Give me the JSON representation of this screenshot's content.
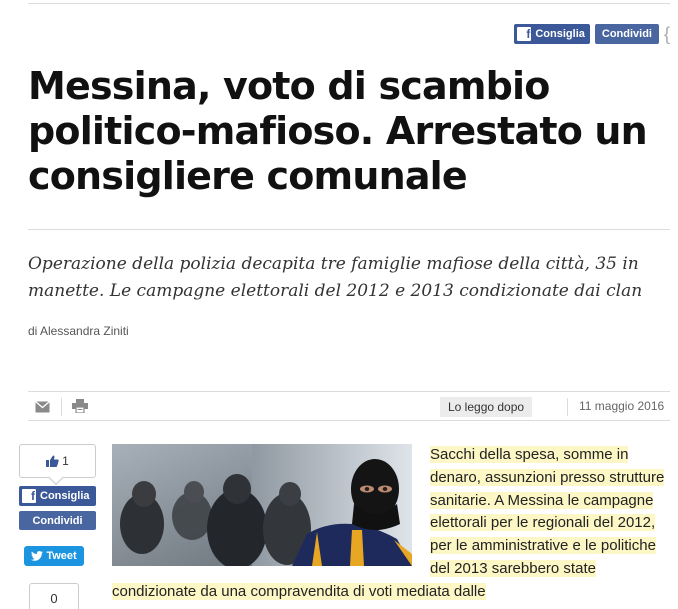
{
  "share_top": {
    "like_label": "Consiglia",
    "share_label": "Condividi"
  },
  "article": {
    "title": "Messina, voto di scambio politico-mafioso. Arrestato un consigliere comunale",
    "subtitle": "Operazione della polizia decapita tre famiglie mafiose della città, 35 in manette. Le campagne elettorali del 2012 e 2013 condizionate dai clan",
    "author": "di Alessandra Ziniti",
    "date": "11 maggio 2016",
    "body": "Sacchi della spesa, somme in denaro, assunzioni presso strutture sanitarie. A Messina le campagne elettorali per le regionali del 2012, per le amministrative e le politiche del 2013 sarebbero state condizionate da una compravendita di voti mediata dalle"
  },
  "toolbar": {
    "email_icon": "envelope-icon",
    "print_icon": "printer-icon",
    "read_later_label": "Lo leggo dopo"
  },
  "social_side": {
    "like_count": "1",
    "like_label": "Consiglia",
    "share_label": "Condividi",
    "tweet_label": "Tweet",
    "share_count": "0"
  },
  "colors": {
    "facebook": "#3b5998",
    "twitter": "#1b95e0",
    "highlight": "#fdf7c6"
  }
}
